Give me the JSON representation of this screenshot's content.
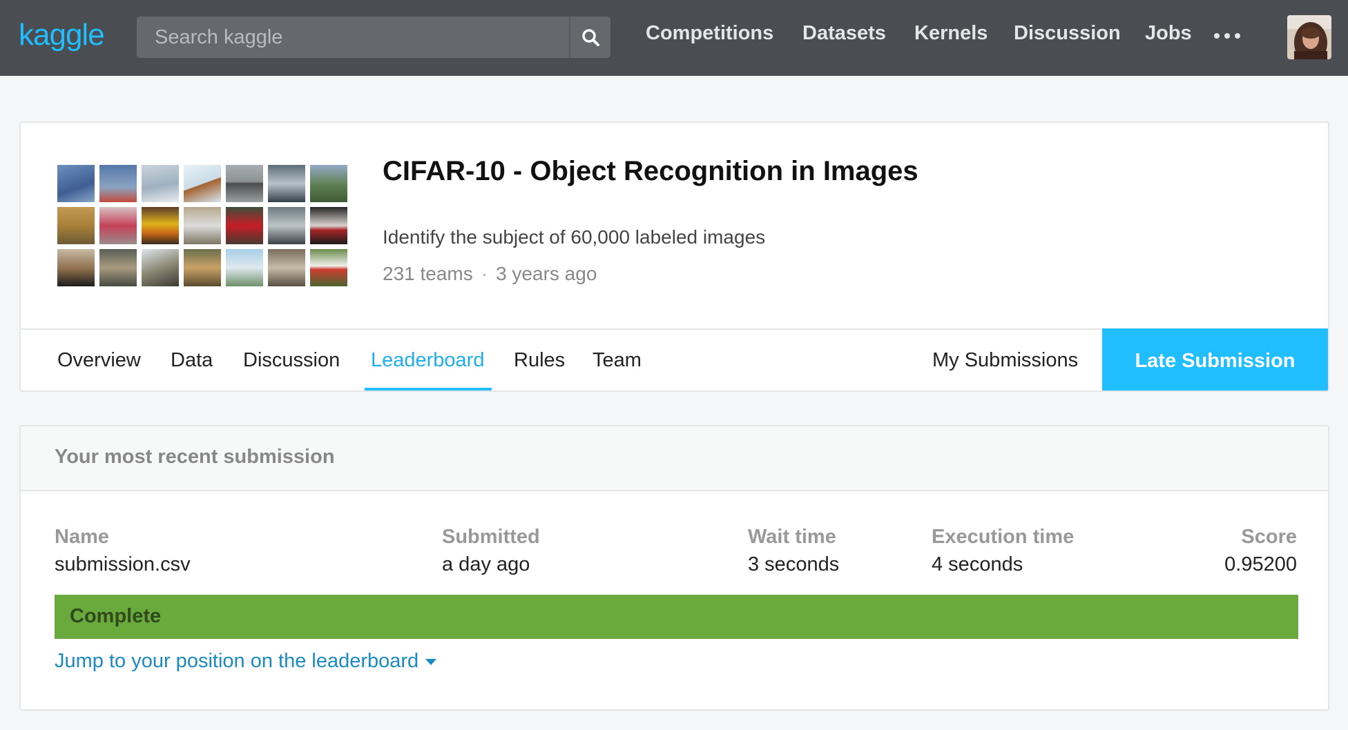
{
  "header": {
    "logo": "kaggle",
    "search": {
      "placeholder": "Search kaggle",
      "value": ""
    },
    "nav": [
      {
        "label": "Competitions"
      },
      {
        "label": "Datasets"
      },
      {
        "label": "Kernels"
      },
      {
        "label": "Discussion"
      },
      {
        "label": "Jobs"
      }
    ],
    "more_icon": "ellipsis-icon",
    "avatar_icon": "user-avatar"
  },
  "competition": {
    "title": "CIFAR-10 - Object Recognition in Images",
    "description": "Identify the subject of 60,000 labeled images",
    "teams": "231 teams",
    "age": "3 years ago",
    "meta_separator": "·",
    "tabs": [
      {
        "label": "Overview"
      },
      {
        "label": "Data"
      },
      {
        "label": "Discussion"
      },
      {
        "label": "Leaderboard",
        "active": true
      },
      {
        "label": "Rules"
      },
      {
        "label": "Team"
      }
    ],
    "my_submissions": "My Submissions",
    "late_submission": "Late Submission"
  },
  "submission": {
    "header": "Your most recent submission",
    "columns": {
      "name": {
        "label": "Name",
        "value": "submission.csv"
      },
      "submitted": {
        "label": "Submitted",
        "value": "a day ago"
      },
      "wait": {
        "label": "Wait time",
        "value": "3 seconds"
      },
      "execution": {
        "label": "Execution time",
        "value": "4 seconds"
      },
      "score": {
        "label": "Score",
        "value": "0.95200"
      }
    },
    "status": "Complete",
    "jump_link": "Jump to your position on the leaderboard"
  },
  "colors": {
    "brand": "#20beff",
    "topbar": "#4a4d52",
    "status_complete": "#6aaa3d",
    "link": "#1a8ac4"
  }
}
